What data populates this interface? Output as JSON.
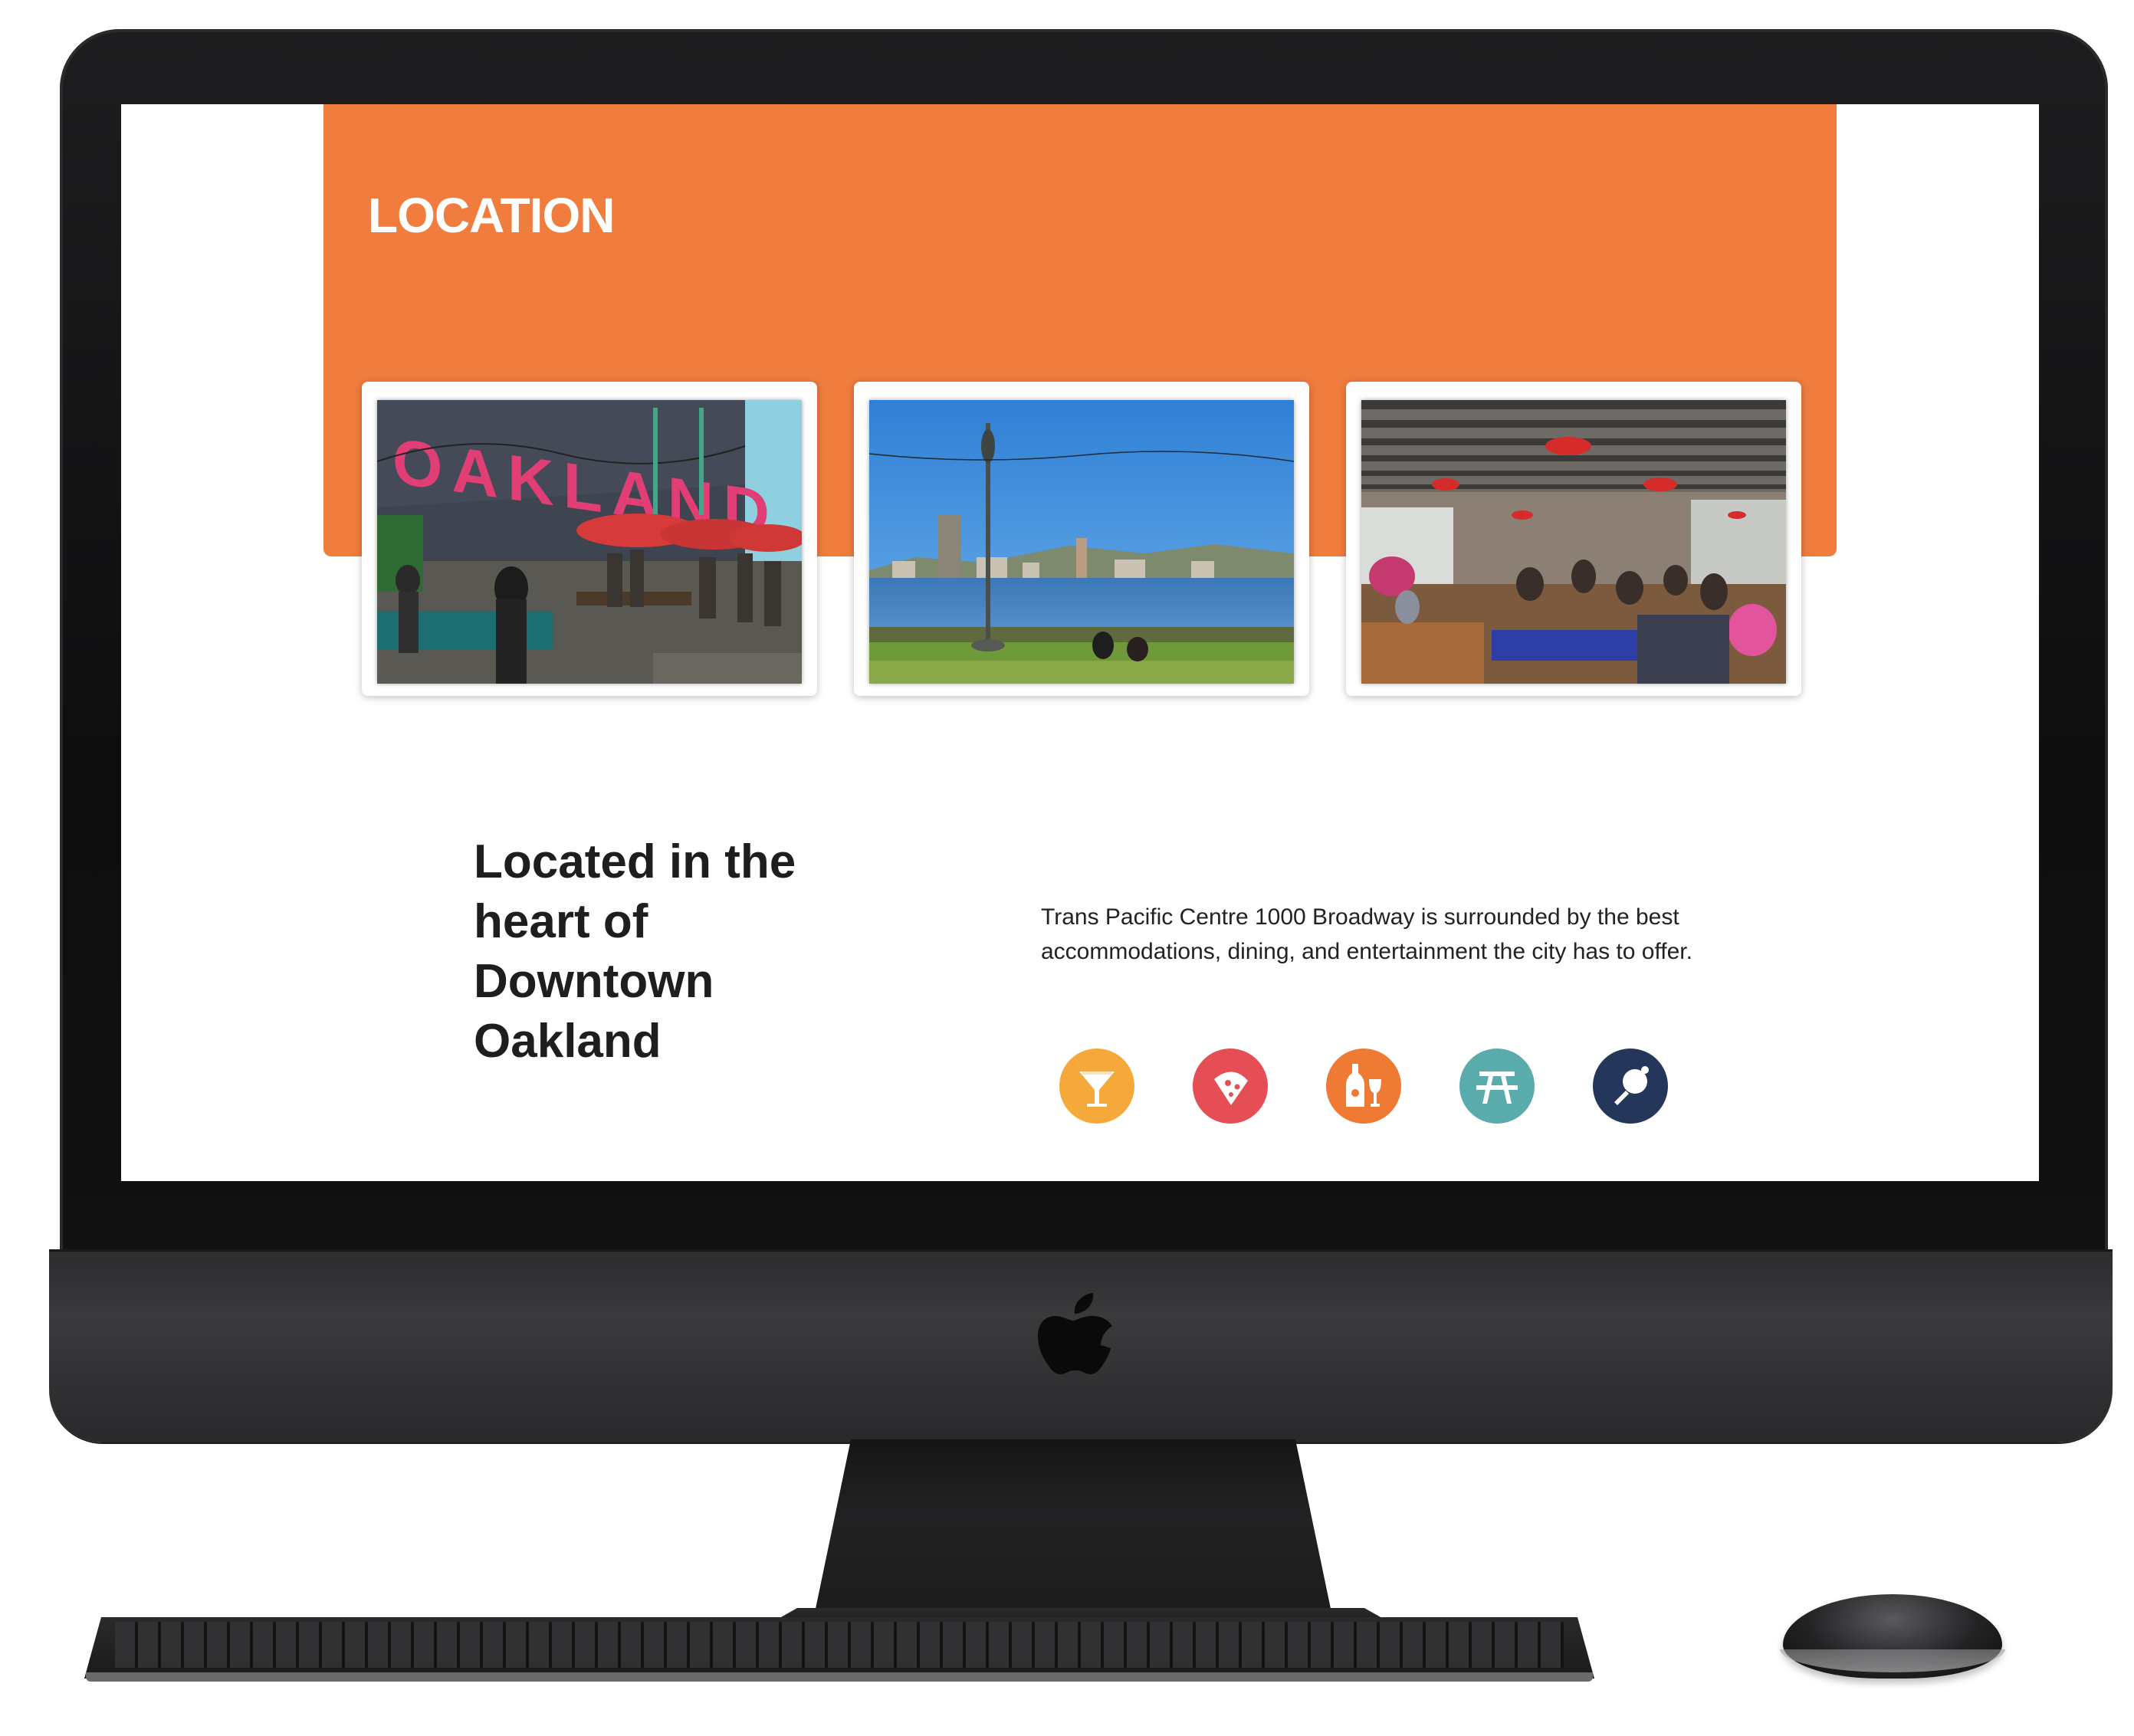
{
  "location_section": {
    "title": "LOCATION",
    "photos": [
      {
        "name": "oakland-mural-photo",
        "sign_text": "OAKLAND"
      },
      {
        "name": "lake-merritt-photo"
      },
      {
        "name": "food-hall-photo"
      }
    ]
  },
  "intro": {
    "heading": "Located in the heart of Downtown Oakland",
    "description": "Trans Pacific Centre 1000 Broadway is surrounded by the best accommodations, dining, and entertainment the city has to offer."
  },
  "amenities": [
    {
      "icon": "cocktail-icon",
      "color": "#f6a93b"
    },
    {
      "icon": "pizza-icon",
      "color": "#e64e55"
    },
    {
      "icon": "wine-bottle-glass-icon",
      "color": "#ef7a33"
    },
    {
      "icon": "picnic-table-icon",
      "color": "#5aacac"
    },
    {
      "icon": "ping-pong-paddle-icon",
      "color": "#24365a"
    }
  ],
  "colors": {
    "accent_orange": "#f07c3d",
    "device_black": "#111111"
  }
}
